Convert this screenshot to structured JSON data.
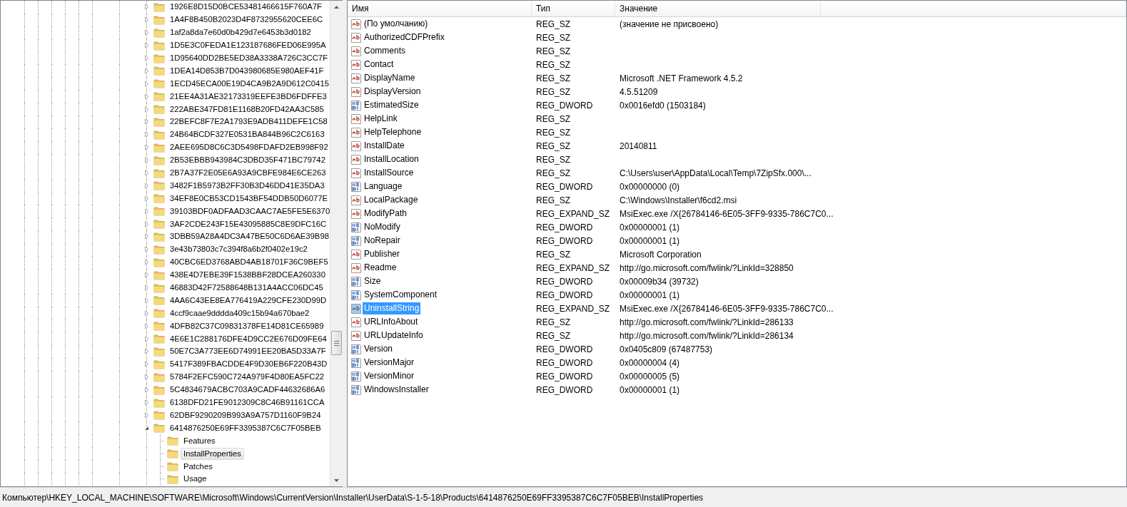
{
  "tree": {
    "items": [
      {
        "label": "1926E8D15D0BCE53481466615F760A7F",
        "expanded": false,
        "selected": false
      },
      {
        "label": "1A4F8B450B2023D4F8732955620CEE6C",
        "expanded": false,
        "selected": false
      },
      {
        "label": "1af2a8da7e60d0b429d7e6453b3d0182",
        "expanded": false,
        "selected": false
      },
      {
        "label": "1D5E3C0FEDA1E123187686FED06E995A",
        "expanded": false,
        "selected": false
      },
      {
        "label": "1D95640DD2BE5ED38A3338A726C3CC7F",
        "expanded": false,
        "selected": false
      },
      {
        "label": "1DEA14D853B7D043980685E980AEF41F",
        "expanded": false,
        "selected": false
      },
      {
        "label": "1ECD45ECA00E19D4CA9B2A9D612C0415",
        "expanded": false,
        "selected": false
      },
      {
        "label": "21EE4A31AE32173319EEFE3BD6FDFFE3",
        "expanded": false,
        "selected": false
      },
      {
        "label": "222ABE347FD81E1168B20FD42AA3C585",
        "expanded": false,
        "selected": false
      },
      {
        "label": "22BEFC8F7E2A1793E9ADB411DEFE1C58",
        "expanded": false,
        "selected": false
      },
      {
        "label": "24B64BCDF327E0531BA844B96C2C6163",
        "expanded": false,
        "selected": false
      },
      {
        "label": "2AEE695D8C6C3D5498FDAFD2EB998F92",
        "expanded": false,
        "selected": false
      },
      {
        "label": "2B53EBBB943984C3DBD35F471BC79742",
        "expanded": false,
        "selected": false
      },
      {
        "label": "2B7A37F2E05E6A93A9CBFE984E6CE263",
        "expanded": false,
        "selected": false
      },
      {
        "label": "3482F1B5973B2FF30B3D46DD41E35DA3",
        "expanded": false,
        "selected": false
      },
      {
        "label": "34EF8E0CB53CD1543BF54DDB50D6077E",
        "expanded": false,
        "selected": false
      },
      {
        "label": "39103BDF0ADFAAD3CAAC7AE5FE5E6370",
        "expanded": false,
        "selected": false
      },
      {
        "label": "3AF2CDE243F15E43095885C8E9DFC16C",
        "expanded": false,
        "selected": false
      },
      {
        "label": "3DBB59A28A4DC3A47BE50C6D6AE39B98",
        "expanded": false,
        "selected": false
      },
      {
        "label": "3e43b73803c7c394f8a6b2f0402e19c2",
        "expanded": false,
        "selected": false
      },
      {
        "label": "40CBC6ED3768ABD4AB18701F36C9BEF5",
        "expanded": false,
        "selected": false
      },
      {
        "label": "438E4D7EBE39F1538BBF28DCEA260330",
        "expanded": false,
        "selected": false
      },
      {
        "label": "46883D42F72588648B131A4ACC06DC45",
        "expanded": false,
        "selected": false
      },
      {
        "label": "4AA6C43EE8EA776419A229CFE230D99D",
        "expanded": false,
        "selected": false
      },
      {
        "label": "4ccf9caae9dddda409c15b94a670bae2",
        "expanded": false,
        "selected": false
      },
      {
        "label": "4DFB82C37C09831378FE14D81CE65989",
        "expanded": false,
        "selected": false
      },
      {
        "label": "4E6E1C288176DFE4D9CC2E676D09FE64",
        "expanded": false,
        "selected": false
      },
      {
        "label": "50E7C3A773EE6D74991EE20BA5D33A7F",
        "expanded": false,
        "selected": false
      },
      {
        "label": "5417F389FBACDDE4F9D30EB6F220B43D",
        "expanded": false,
        "selected": false
      },
      {
        "label": "5784F2EFC590C724A979F4D80EA5FC22",
        "expanded": false,
        "selected": false
      },
      {
        "label": "5C4834679ACBC703A9CADF44632686A6",
        "expanded": false,
        "selected": false
      },
      {
        "label": "6138DFD21FE9012309C8C46B91161CCA",
        "expanded": false,
        "selected": false
      },
      {
        "label": "62DBF9290209B993A9A757D1160F9B24",
        "expanded": false,
        "selected": false
      },
      {
        "label": "6414876250E69FF3395387C6C7F05BEB",
        "expanded": true,
        "selected": false,
        "children": [
          {
            "label": "Features",
            "selected": false
          },
          {
            "label": "InstallProperties",
            "selected": true
          },
          {
            "label": "Patches",
            "selected": false
          },
          {
            "label": "Usage",
            "selected": false
          }
        ]
      }
    ]
  },
  "list": {
    "columns": [
      "Имя",
      "Тип",
      "Значение"
    ],
    "rows": [
      {
        "name": "(По умолчанию)",
        "type": "REG_SZ",
        "value": "(значение не присвоено)",
        "kind": "string",
        "selected": false
      },
      {
        "name": "AuthorizedCDFPrefix",
        "type": "REG_SZ",
        "kind": "string",
        "selected": false
      },
      {
        "name": "Comments",
        "type": "REG_SZ",
        "kind": "string",
        "selected": false
      },
      {
        "name": "Contact",
        "type": "REG_SZ",
        "kind": "string",
        "selected": false
      },
      {
        "name": "DisplayName",
        "type": "REG_SZ",
        "value": "Microsoft .NET Framework 4.5.2",
        "kind": "string",
        "selected": false
      },
      {
        "name": "DisplayVersion",
        "type": "REG_SZ",
        "value": "4.5.51209",
        "kind": "string",
        "selected": false
      },
      {
        "name": "EstimatedSize",
        "type": "REG_DWORD",
        "value": "0x0016efd0 (1503184)",
        "kind": "binary",
        "selected": false
      },
      {
        "name": "HelpLink",
        "type": "REG_SZ",
        "kind": "string",
        "selected": false
      },
      {
        "name": "HelpTelephone",
        "type": "REG_SZ",
        "kind": "string",
        "selected": false
      },
      {
        "name": "InstallDate",
        "type": "REG_SZ",
        "value": "20140811",
        "kind": "string",
        "selected": false
      },
      {
        "name": "InstallLocation",
        "type": "REG_SZ",
        "kind": "string",
        "selected": false
      },
      {
        "name": "InstallSource",
        "type": "REG_SZ",
        "value": "C:\\Users\\user\\AppData\\Local\\Temp\\7ZipSfx.000\\...",
        "kind": "string",
        "selected": false
      },
      {
        "name": "Language",
        "type": "REG_DWORD",
        "value": "0x00000000 (0)",
        "kind": "binary",
        "selected": false
      },
      {
        "name": "LocalPackage",
        "type": "REG_SZ",
        "value": "C:\\Windows\\Installer\\f6cd2.msi",
        "kind": "string",
        "selected": false
      },
      {
        "name": "ModifyPath",
        "type": "REG_EXPAND_SZ",
        "value": "MsiExec.exe /X{26784146-6E05-3FF9-9335-786C7C0...",
        "kind": "string",
        "selected": false
      },
      {
        "name": "NoModify",
        "type": "REG_DWORD",
        "value": "0x00000001 (1)",
        "kind": "binary",
        "selected": false
      },
      {
        "name": "NoRepair",
        "type": "REG_DWORD",
        "value": "0x00000001 (1)",
        "kind": "binary",
        "selected": false
      },
      {
        "name": "Publisher",
        "type": "REG_SZ",
        "value": "Microsoft Corporation",
        "kind": "string",
        "selected": false
      },
      {
        "name": "Readme",
        "type": "REG_EXPAND_SZ",
        "value": "http://go.microsoft.com/fwlink/?LinkId=328850",
        "kind": "string",
        "selected": false
      },
      {
        "name": "Size",
        "type": "REG_DWORD",
        "value": "0x00009b34 (39732)",
        "kind": "binary",
        "selected": false
      },
      {
        "name": "SystemComponent",
        "type": "REG_DWORD",
        "value": "0x00000001 (1)",
        "kind": "binary",
        "selected": false
      },
      {
        "name": "UninstallString",
        "type": "REG_EXPAND_SZ",
        "value": "MsiExec.exe /X{26784146-6E05-3FF9-9335-786C7C0...",
        "kind": "string",
        "selected": true
      },
      {
        "name": "URLInfoAbout",
        "type": "REG_SZ",
        "value": "http://go.microsoft.com/fwlink/?LinkId=286133",
        "kind": "string",
        "selected": false
      },
      {
        "name": "URLUpdateInfo",
        "type": "REG_SZ",
        "value": "http://go.microsoft.com/fwlink/?LinkId=286134",
        "kind": "string",
        "selected": false
      },
      {
        "name": "Version",
        "type": "REG_DWORD",
        "value": "0x0405c809 (67487753)",
        "kind": "binary",
        "selected": false
      },
      {
        "name": "VersionMajor",
        "type": "REG_DWORD",
        "value": "0x00000004 (4)",
        "kind": "binary",
        "selected": false
      },
      {
        "name": "VersionMinor",
        "type": "REG_DWORD",
        "value": "0x00000005 (5)",
        "kind": "binary",
        "selected": false
      },
      {
        "name": "WindowsInstaller",
        "type": "REG_DWORD",
        "value": "0x00000001 (1)",
        "kind": "binary",
        "selected": false
      }
    ]
  },
  "status_bar": "Компьютер\\HKEY_LOCAL_MACHINE\\SOFTWARE\\Microsoft\\Windows\\CurrentVersion\\Installer\\UserData\\S-1-5-18\\Products\\6414876250E69FF3395387C6C7F05BEB\\InstallProperties"
}
